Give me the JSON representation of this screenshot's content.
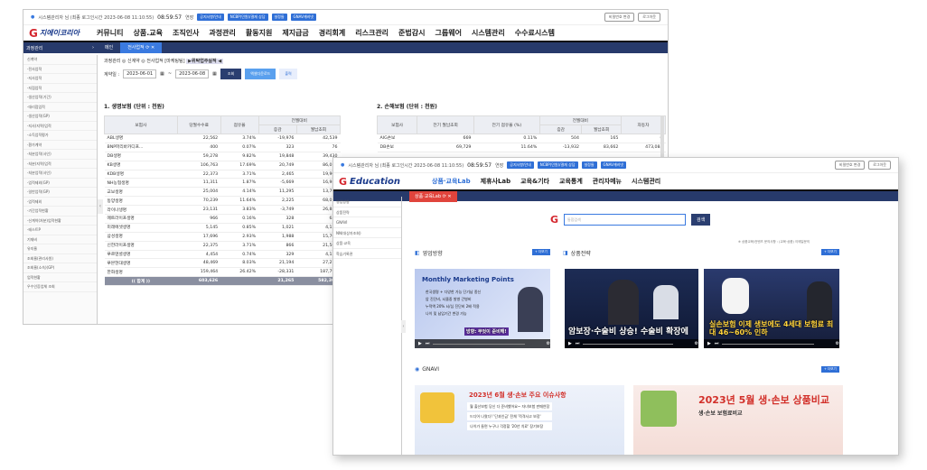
{
  "window1": {
    "topbar": {
      "user_info": "시스템관리자 님 (최종 로그인시간 2023-06-08 11:10:55)",
      "clock": "08:59:57",
      "extend": "연장",
      "quick_buttons": [
        "공지사항/안내",
        "NCBP(민원)/결재 상담",
        "설정들",
        "GNAV캐비넷"
      ],
      "change_pw": "비밀번호 변경",
      "logout": "로그아웃"
    },
    "logo": "지에이코리아",
    "menu": [
      "커뮤니티",
      "상품.교육",
      "조직인사",
      "과정관리",
      "활동지원",
      "제지급금",
      "경리회계",
      "리스크관리",
      "준법감시",
      "그룹웨어",
      "시스템관리",
      "수수료시스템"
    ],
    "side_title": "과정관리",
    "tabs": [
      "메인",
      "전사업적"
    ],
    "sidebar_items": [
      "신계약",
      "-전사업적",
      "-지사업적",
      "-지점업적",
      "-생산업적(기간)",
      "-대리점업적",
      "-생산업적(GP)",
      "-지사(지역)업적",
      "-소득업적평가",
      "-환가계약",
      "-처분업적(사인)",
      "-처분(지역)업적",
      "-처분업적(사인)",
      "-업적제외(GP)",
      "-일반업적(GP)",
      "-업적제외",
      "-기간업적현황",
      "-신계약(처분)업적현황",
      "-테스트P",
      "기재비",
      "유지율",
      "조회율(관리사원)",
      "조회율(소속)(GP)",
      "업적현황",
      "우수인증업체 조회"
    ],
    "breadcrumb": "과정관리 ◎ 신계약 ◎ 전사업적 [마케팅팀]",
    "chip": "▶위탁업주실적 ◀",
    "filter": {
      "label": "계약일 :",
      "date_from": "2023-06-01",
      "date_to": "2023-06-08",
      "search": "조회",
      "excel": "엑셀다운로드",
      "print": "출력"
    },
    "life": {
      "title": "1. 생명보험 (단위 : 천원)",
      "headers": [
        "보험사",
        "당월수수료",
        "점유율",
        "전월대비",
        "증감",
        "월납초회"
      ],
      "rows": [
        [
          "ABL생명",
          "22,562",
          "3.74%",
          "-19,976",
          "42,539"
        ],
        [
          "BNP파리바카디프...",
          "400",
          "0.07%",
          "323",
          "76"
        ],
        [
          "DB생명",
          "59,278",
          "9.82%",
          "19,848",
          "39,430"
        ],
        [
          "KB생명",
          "106,763",
          "17.69%",
          "20,749",
          "86,014"
        ],
        [
          "KDB생명",
          "22,373",
          "3.71%",
          "2,465",
          "19,908"
        ],
        [
          "NH농협생명",
          "11,311",
          "1.87%",
          "-5,669",
          "16,980"
        ],
        [
          "교보생명",
          "25,004",
          "4.14%",
          "11,295",
          "13,709"
        ],
        [
          "동양생명",
          "70,239",
          "11.64%",
          "2,225",
          "68,014"
        ],
        [
          "라이나생명",
          "23,131",
          "3.83%",
          "-3,749",
          "26,880"
        ],
        [
          "메트라이프생명",
          "966",
          "0.16%",
          "328",
          "638"
        ],
        [
          "미래에셋생명",
          "5,145",
          "0.85%",
          "1,021",
          "4,124"
        ],
        [
          "삼성생명",
          "17,696",
          "2.93%",
          "1,988",
          "15,708"
        ],
        [
          "신한라이프생명",
          "22,375",
          "3.71%",
          "866",
          "21,509"
        ],
        [
          "푸르덴셜생명",
          "4,454",
          "0.74%",
          "329",
          "4,125"
        ],
        [
          "푸본현대생명",
          "48,469",
          "8.03%",
          "21,194",
          "27,275"
        ],
        [
          "한화생명",
          "159,464",
          "26.42%",
          "-28,331",
          "187,795"
        ]
      ],
      "total": [
        "(( 합계 ))",
        "603,626",
        "",
        "21,265",
        "582,361"
      ]
    },
    "nonlife": {
      "title": "2. 손해보험 (단위 : 천원)",
      "headers": [
        "보험사",
        "전기 월납초회",
        "전기 점유율 (%)",
        "전월대비",
        "증감",
        "월납초회",
        "자동차"
      ],
      "rows": [
        [
          "AIG손보",
          "669",
          "0.11%",
          "504",
          "165",
          "0"
        ],
        [
          "DB손보",
          "69,729",
          "11.64%",
          "-13,932",
          "83,662",
          "473,084"
        ]
      ]
    }
  },
  "window2": {
    "topbar": {
      "user_info": "시스템관리자 님 (최종 로그인시간 2023-06-08 11:10:55)",
      "clock": "08:59:57",
      "extend": "연장",
      "quick_buttons": [
        "공지사항/안내",
        "NCBP(민원)/결재 상담",
        "설정들",
        "GNAV캐비넷"
      ],
      "change_pw": "비밀번호 변경",
      "logout": "로그아웃"
    },
    "logo": "Education",
    "menu": [
      "상품·교육Lab",
      "제휴사Lab",
      "교육&기타",
      "교육통계",
      "관리자메뉴",
      "시스템관리"
    ],
    "tab": "상품·교육Lab",
    "sidebar_items": [
      "영업방향",
      "상품전략",
      "GNAVI",
      "NN(대상자조회)",
      "상품·교육",
      "학습기록관"
    ],
    "search": {
      "placeholder": "통합검색",
      "button": "검색"
    },
    "notice": "※ 상품교육/컨텐츠 문의사항 : (교육·상품) 이메일문의",
    "panels": {
      "sales": "영업방향",
      "product": "상품전략",
      "gnavi": "GNAVI",
      "more": "+ 더보기"
    },
    "video1": {
      "title": "Monthly Marketing Points",
      "lines": [
        "한국생명 + 다양한 가능 단기납 종신",
        "암 진단비, 뇌졸중 발병 간병비",
        "누적액 20% 뇌/심 진단비 2배 적용",
        "나이 및 납입기간 변경 가능"
      ],
      "caption": "방향: 무엇이 준비해!"
    },
    "video2": {
      "caption": "암보장·수술비 상승! 수술비 확장에"
    },
    "video3": {
      "caption": "실손보험 이제 생보에도 4세대 보험료 최대 46~60% 인하"
    },
    "banner1": {
      "title": "2023년 6월 생·손보 주요 이슈사항",
      "lines": [
        "월 출산보험 당신 다 준비했어요~ 자녀보험 판매연장",
        "드디어 나왔다! '단과인금' 전체 '적격사고 보장'",
        "나이가 들면 누구나 걱정할 '20년 치료' 장기보장"
      ]
    },
    "banner2": {
      "title": "2023년 5월 생·손보 상품비교",
      "subtitle": "생·손보 보험료비교"
    }
  }
}
